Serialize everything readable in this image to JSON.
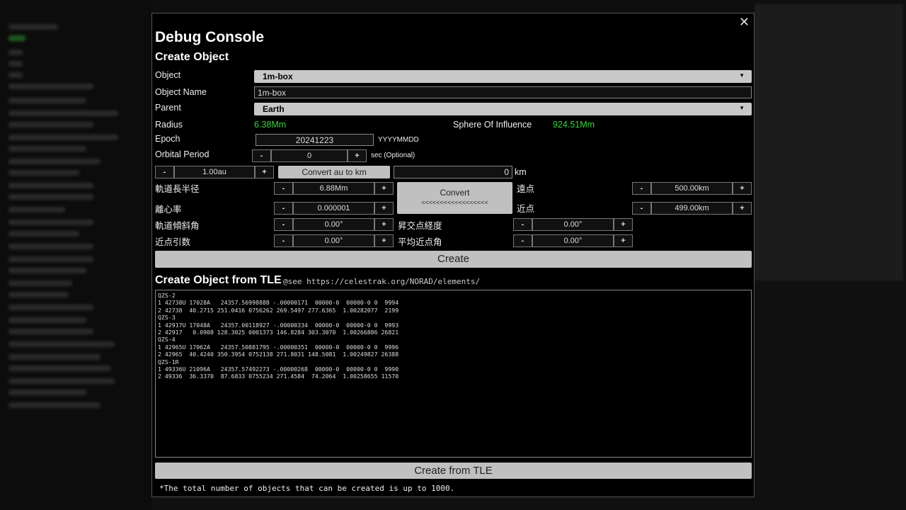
{
  "modal": {
    "title": "Debug Console",
    "close": "✕"
  },
  "create": {
    "section_title": "Create Object",
    "object_label": "Object",
    "object_value": "1m-box",
    "name_label": "Object Name",
    "name_value": "1m-box",
    "parent_label": "Parent",
    "parent_value": "Earth",
    "radius_label": "Radius",
    "radius_value": "6.38Mm",
    "soi_label": "Sphere Of Influence",
    "soi_value": "924.51Mm",
    "epoch_label": "Epoch",
    "epoch_value": "20241223",
    "epoch_hint": "YYYYMMDD",
    "period_label": "Orbital Period",
    "period_value": "0",
    "period_hint": "sec (Optional)",
    "au_value": "1.00au",
    "convert_au_label": "Convert au to km",
    "km_value": "0",
    "km_unit": "km",
    "sma_label": "軌道長半径",
    "sma_value": "6.88Mm",
    "ecc_label": "離心率",
    "ecc_value": "0.000001",
    "inc_label": "軌道傾斜角",
    "inc_value": "0.00°",
    "argp_label": "近点引数",
    "argp_value": "0.00°",
    "convert_label": "Convert",
    "convert_arrows": "<<<<<<<<<<<<<<<<<<",
    "apo_label": "遠点",
    "apo_value": "500.00km",
    "peri_label": "近点",
    "peri_value": "499.00km",
    "raan_label": "昇交点経度",
    "raan_value": "0.00°",
    "mean_anom_label": "平均近点角",
    "mean_anom_value": "0.00°",
    "minus": "-",
    "plus": "+",
    "create_button": "Create"
  },
  "tle": {
    "section_title": "Create Object from TLE",
    "see_text": "@see  https://celestrak.org/NORAD/elements/",
    "text": "QZS-2\n1 42738U 17028A   24357.56998888 -.00000171  00000-0  00000-0 0  9994\n2 42738  40.2715 251.0416 0756262 269.5497 277.6365  1.00282077  2199\nQZS-3\n1 42917U 17048A   24357.00118927 -.00000334  00000-0  00000-0 0  9993\n2 42917   0.0908 128.3025 0001373 146.8284 303.3070  1.00266886 26821\nQZS-4\n1 42965U 17062A   24357.50881795 -.00000351  00000-0  00000-0 0  9996\n2 42965  40.4240 350.3954 0752138 271.8031 148.5081  1.00249827 26388\nQZS-1R\n1 49336U 21096A   24357.57492273 -.00000268  00000-0  00000-0 0  9990\n2 49336  36.3370  87.6833 0755234 271.4584  74.2064  1.00258655 11570\n",
    "create_button": "Create from TLE",
    "footnote": "*The total number of objects that can be created is up to 1000."
  }
}
